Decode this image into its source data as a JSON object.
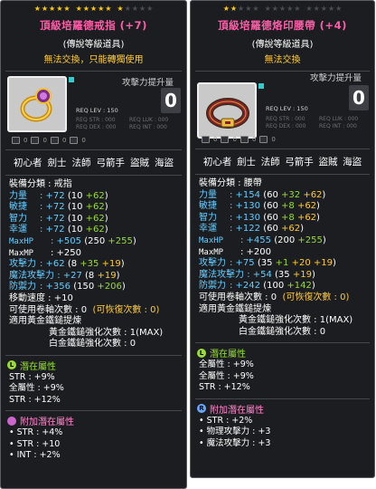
{
  "ring": {
    "stars": {
      "filled": 11,
      "total": 15
    },
    "title": "頂級培羅德戒指",
    "enhance": "(+7)",
    "subtitle": "(傳說等級道具)",
    "warning": "無法交換，只能轉獨使用",
    "attack_label": "攻擊力提升量",
    "attack_value": "0",
    "req_lev": "REQ LEV : 150",
    "req_rows": [
      "REQ STR : 000",
      "REQ LUK : 000",
      "REQ DEX : 000",
      "REQ INT : 000"
    ],
    "flags": [
      "0",
      "0",
      "0",
      "0"
    ],
    "jobs": [
      "初心者",
      "劍士",
      "法師",
      "弓箭手",
      "盜賊",
      "海盜"
    ],
    "category": "裝備分類 : 戒指",
    "stats": [
      {
        "label": "力量",
        "value": ": +72",
        "base": "(10 ",
        "bonus": "+62",
        "close": ")"
      },
      {
        "label": "敏捷",
        "value": ": +72",
        "base": "(10 ",
        "bonus": "+62",
        "close": ")"
      },
      {
        "label": "智力",
        "value": ": +72",
        "base": "(10 ",
        "bonus": "+62",
        "close": ")"
      },
      {
        "label": "幸運",
        "value": ": +72",
        "base": "(10 ",
        "bonus": "+62",
        "close": ")"
      }
    ],
    "maxhp": {
      "label": "MaxHP",
      "value": ": +505",
      "base": "(250 ",
      "bonus": "+255",
      "close": ")"
    },
    "maxmp": {
      "label": "MaxMP",
      "value": ": +250"
    },
    "atk": {
      "label": "攻擊力",
      "value": ": +62",
      "base": "(8 ",
      "bonus": "+35 ",
      "extra": "+19",
      "close": ")"
    },
    "matk": {
      "label": "魔法攻擊力",
      "value": ": +27",
      "base": "(8 ",
      "extra": "+19",
      "close": ")"
    },
    "def": {
      "label": "防禦力",
      "value": ": +356",
      "base": "(150 ",
      "bonus": "+206",
      "close": ")"
    },
    "speed": "移動速度 : +10",
    "slots": "可使用卷軸次數 : 0",
    "slots_recover": "(可恢復次數 : 0)",
    "hammer": "適用黃金鐵鎚提煉",
    "hammer_count": "黃金鐵鎚強化次數 : 1(MAX)",
    "platinum": "白金鐵鎚強化次數 : 0",
    "potential_label": "潛在屬性",
    "potential": [
      "STR : +9%",
      "全屬性 : +9%",
      "STR : +12%"
    ],
    "add_potential_label": "附加潛在屬性",
    "add_potential": [
      "• STR : +4%",
      "• STR : +10",
      "• INT : +2%"
    ]
  },
  "belt": {
    "stars": {
      "filled": 2,
      "total": 15
    },
    "title": "頂級培羅德烙印腰帶",
    "enhance": "(+4)",
    "subtitle": "(傳說等級道具)",
    "warning": "無法交換",
    "attack_label": "攻擊力提升量",
    "attack_value": "0",
    "req_lev": "REQ LEV : 150",
    "req_rows": [
      "REQ STR : 000",
      "REQ LUK : 000",
      "REQ DEX : 000",
      "REQ INT : 000"
    ],
    "flags": [
      "0",
      "0",
      "0",
      "0"
    ],
    "jobs": [
      "初心者",
      "劍士",
      "法師",
      "弓箭手",
      "盜賊",
      "海盜"
    ],
    "category": "裝備分類 : 腰帶",
    "stats": [
      {
        "label": "力量",
        "value": ": +154",
        "base": "(60 ",
        "bonus": "+32 ",
        "extra": "+62",
        "close": ")"
      },
      {
        "label": "敏捷",
        "value": ": +130",
        "base": "(60 ",
        "bonus": "+8 ",
        "extra": "+62",
        "close": ")"
      },
      {
        "label": "智力",
        "value": ": +130",
        "base": "(60 ",
        "bonus": "+8 ",
        "extra": "+62",
        "close": ")"
      },
      {
        "label": "幸運",
        "value": ": +122",
        "base": "(60 ",
        "extra": "+62",
        "close": ")"
      }
    ],
    "maxhp": {
      "label": "MaxHP",
      "value": ": +455",
      "base": "(200 ",
      "bonus": "+255",
      "close": ")"
    },
    "maxmp": {
      "label": "MaxMP",
      "value": ": +200"
    },
    "atk": {
      "label": "攻擊力",
      "value": ": +75",
      "base": "(35 ",
      "bonus": "+1 ",
      "extra": "+20 +19",
      "close": ")"
    },
    "matk": {
      "label": "魔法攻擊力",
      "value": ": +54",
      "base": "(35 ",
      "extra": "+19",
      "close": ")"
    },
    "def": {
      "label": "防禦力",
      "value": ": +242",
      "base": "(100 ",
      "bonus": "+142",
      "close": ")"
    },
    "slots": "可使用卷軸次數 : 0",
    "slots_recover": "(可恢復次數 : 0)",
    "hammer": "適用黃金鐵鎚提煉",
    "hammer_count": "黃金鐵鎚強化次數 : 1(MAX)",
    "platinum": "白金鐵鎚強化次數 : 0",
    "potential_label": "潛在屬性",
    "potential": [
      "全屬性 : +9%",
      "全屬性 : +9%",
      "STR : +12%"
    ],
    "add_potential_label": "附加潛在屬性",
    "add_potential": [
      "• STR : +2%",
      "• 物理攻擊力 : +3",
      "• 魔法攻擊力 : +3"
    ]
  },
  "colors": {
    "title": "#ff5da8",
    "stat_label": "#66ccff",
    "bonus": "#99dd33",
    "extra": "#ffcc33",
    "star_on": "#ffcc00"
  }
}
